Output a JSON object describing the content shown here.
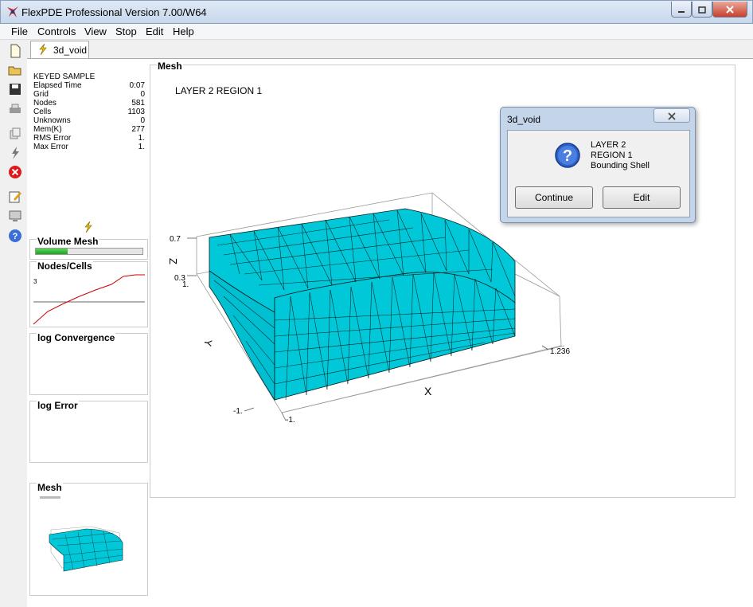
{
  "window": {
    "title": "FlexPDE Professional Version 7.00/W64"
  },
  "menu": [
    "File",
    "Controls",
    "View",
    "Stop",
    "Edit",
    "Help"
  ],
  "toolbar_icons": [
    "new-file-icon",
    "open-folder-icon",
    "save-icon",
    "print-icon",
    "copy-icon",
    "run-icon",
    "stop-icon",
    "edit-icon",
    "monitor-icon",
    "help-icon"
  ],
  "tab": {
    "label": "3d_void"
  },
  "stats": {
    "heading": "KEYED SAMPLE",
    "rows": [
      {
        "label": "Elapsed Time",
        "value": "0:07"
      },
      {
        "label": "Grid",
        "value": "0"
      },
      {
        "label": "Nodes",
        "value": "581"
      },
      {
        "label": "Cells",
        "value": "1103"
      },
      {
        "label": "Unknowns",
        "value": "0"
      },
      {
        "label": "Mem(K)",
        "value": "277"
      },
      {
        "label": "RMS Error",
        "value": "1."
      },
      {
        "label": "Max Error",
        "value": "1."
      }
    ]
  },
  "panels": {
    "volume_mesh": {
      "title": "Volume Mesh",
      "progress": 0.3
    },
    "nodes_cells": {
      "title": "Nodes/Cells",
      "ylabel": "3"
    },
    "log_convergence": {
      "title": "log Convergence"
    },
    "log_error": {
      "title": "log Error"
    },
    "mesh_thumb": {
      "title": "Mesh"
    }
  },
  "mesh": {
    "frame_title": "Mesh",
    "plot_title": "LAYER 2  REGION 1",
    "axis_z": "Z",
    "axis_y": "Y",
    "axis_x": "X",
    "ticks": {
      "z_top": "0.7",
      "z_bottom": "0.3",
      "y_top": "1.",
      "y_bottom": "-1.",
      "x_left": "-1.",
      "x_right": "1.236"
    },
    "mesh_color": "#00c8d8"
  },
  "dialog": {
    "title": "3d_void",
    "lines": [
      "LAYER 2",
      "REGION 1",
      "Bounding Shell"
    ],
    "buttons": {
      "continue": "Continue",
      "edit": "Edit"
    }
  }
}
